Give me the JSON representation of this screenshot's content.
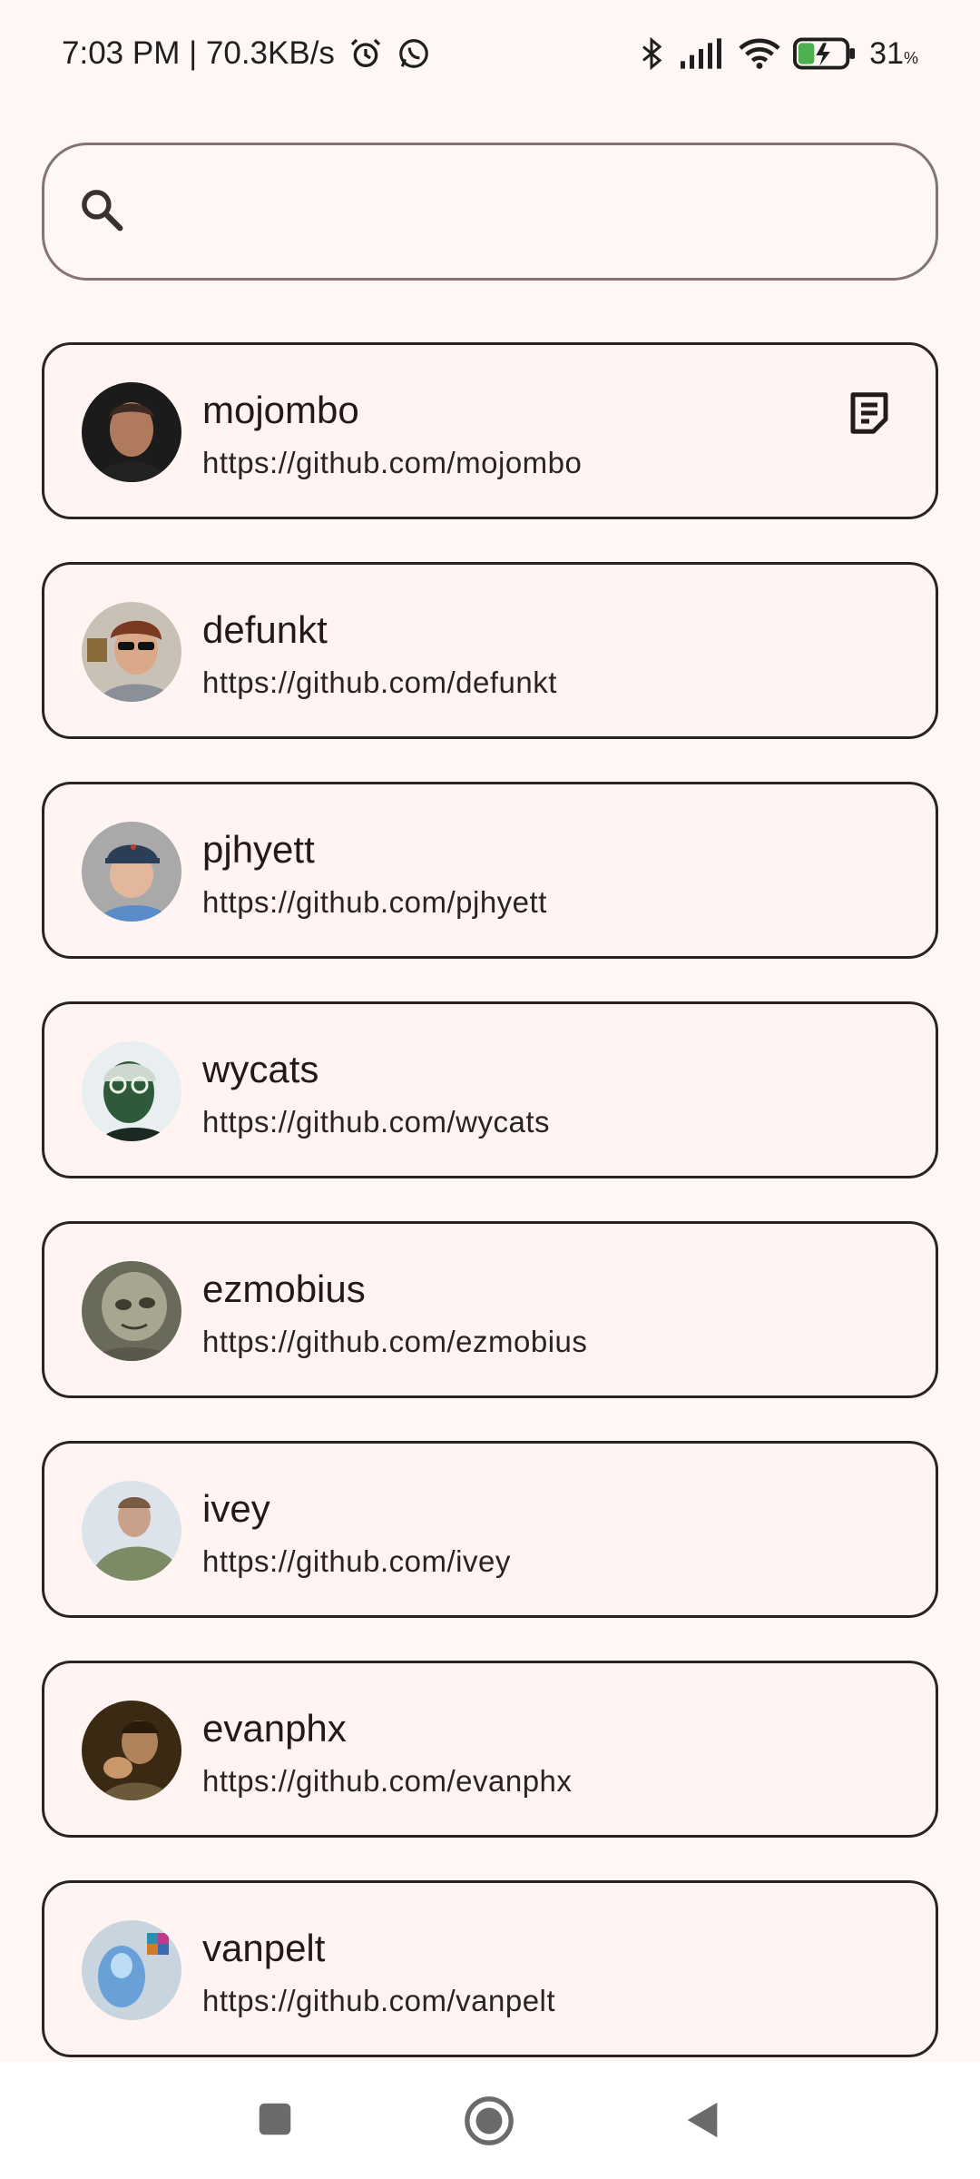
{
  "status_bar": {
    "time_speed": "7:03 PM | 70.3KB/s",
    "battery_level": "31",
    "battery_unit": "%"
  },
  "search": {
    "placeholder": "",
    "value": ""
  },
  "users": [
    {
      "name": "mojombo",
      "url": "https://github.com/mojombo",
      "has_note": true
    },
    {
      "name": "defunkt",
      "url": "https://github.com/defunkt",
      "has_note": false
    },
    {
      "name": "pjhyett",
      "url": "https://github.com/pjhyett",
      "has_note": false
    },
    {
      "name": "wycats",
      "url": "https://github.com/wycats",
      "has_note": false
    },
    {
      "name": "ezmobius",
      "url": "https://github.com/ezmobius",
      "has_note": false
    },
    {
      "name": "ivey",
      "url": "https://github.com/ivey",
      "has_note": false
    },
    {
      "name": "evanphx",
      "url": "https://github.com/evanphx",
      "has_note": false
    },
    {
      "name": "vanpelt",
      "url": "https://github.com/vanpelt",
      "has_note": false
    }
  ],
  "icons": {
    "search": "search-icon",
    "note": "note-icon",
    "nav_recents": "square-icon",
    "nav_home": "circle-icon",
    "nav_back": "triangle-back-icon"
  }
}
